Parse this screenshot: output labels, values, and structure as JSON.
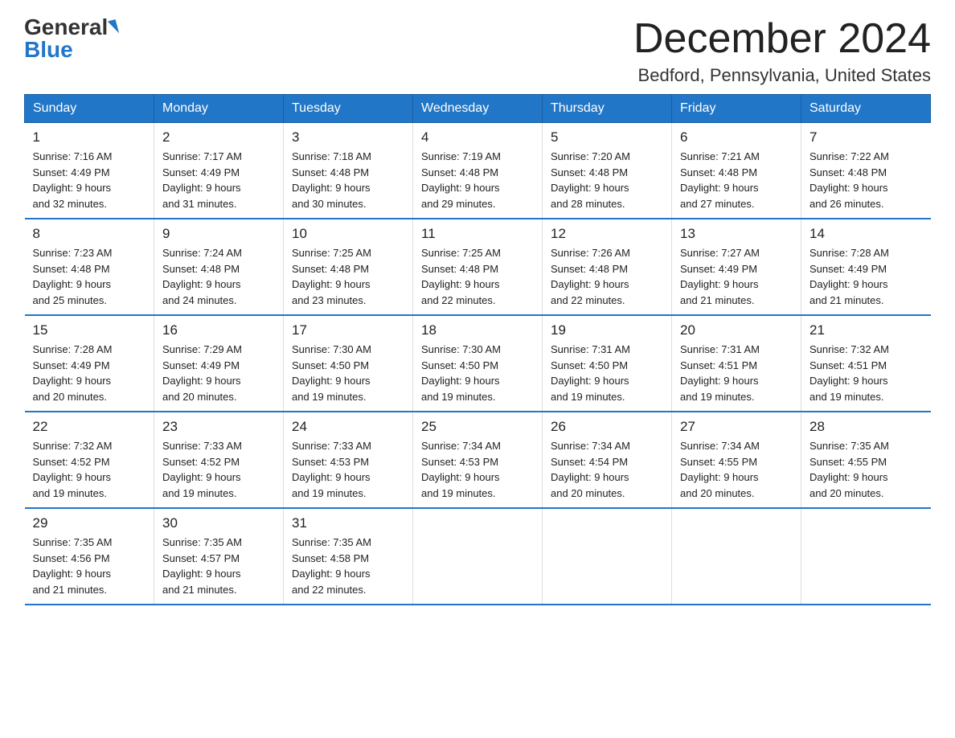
{
  "header": {
    "logo_general": "General",
    "logo_blue": "Blue",
    "title": "December 2024",
    "subtitle": "Bedford, Pennsylvania, United States"
  },
  "days_of_week": [
    "Sunday",
    "Monday",
    "Tuesday",
    "Wednesday",
    "Thursday",
    "Friday",
    "Saturday"
  ],
  "weeks": [
    [
      {
        "day": "1",
        "sunrise": "7:16 AM",
        "sunset": "4:49 PM",
        "daylight": "9 hours and 32 minutes."
      },
      {
        "day": "2",
        "sunrise": "7:17 AM",
        "sunset": "4:49 PM",
        "daylight": "9 hours and 31 minutes."
      },
      {
        "day": "3",
        "sunrise": "7:18 AM",
        "sunset": "4:48 PM",
        "daylight": "9 hours and 30 minutes."
      },
      {
        "day": "4",
        "sunrise": "7:19 AM",
        "sunset": "4:48 PM",
        "daylight": "9 hours and 29 minutes."
      },
      {
        "day": "5",
        "sunrise": "7:20 AM",
        "sunset": "4:48 PM",
        "daylight": "9 hours and 28 minutes."
      },
      {
        "day": "6",
        "sunrise": "7:21 AM",
        "sunset": "4:48 PM",
        "daylight": "9 hours and 27 minutes."
      },
      {
        "day": "7",
        "sunrise": "7:22 AM",
        "sunset": "4:48 PM",
        "daylight": "9 hours and 26 minutes."
      }
    ],
    [
      {
        "day": "8",
        "sunrise": "7:23 AM",
        "sunset": "4:48 PM",
        "daylight": "9 hours and 25 minutes."
      },
      {
        "day": "9",
        "sunrise": "7:24 AM",
        "sunset": "4:48 PM",
        "daylight": "9 hours and 24 minutes."
      },
      {
        "day": "10",
        "sunrise": "7:25 AM",
        "sunset": "4:48 PM",
        "daylight": "9 hours and 23 minutes."
      },
      {
        "day": "11",
        "sunrise": "7:25 AM",
        "sunset": "4:48 PM",
        "daylight": "9 hours and 22 minutes."
      },
      {
        "day": "12",
        "sunrise": "7:26 AM",
        "sunset": "4:48 PM",
        "daylight": "9 hours and 22 minutes."
      },
      {
        "day": "13",
        "sunrise": "7:27 AM",
        "sunset": "4:49 PM",
        "daylight": "9 hours and 21 minutes."
      },
      {
        "day": "14",
        "sunrise": "7:28 AM",
        "sunset": "4:49 PM",
        "daylight": "9 hours and 21 minutes."
      }
    ],
    [
      {
        "day": "15",
        "sunrise": "7:28 AM",
        "sunset": "4:49 PM",
        "daylight": "9 hours and 20 minutes."
      },
      {
        "day": "16",
        "sunrise": "7:29 AM",
        "sunset": "4:49 PM",
        "daylight": "9 hours and 20 minutes."
      },
      {
        "day": "17",
        "sunrise": "7:30 AM",
        "sunset": "4:50 PM",
        "daylight": "9 hours and 19 minutes."
      },
      {
        "day": "18",
        "sunrise": "7:30 AM",
        "sunset": "4:50 PM",
        "daylight": "9 hours and 19 minutes."
      },
      {
        "day": "19",
        "sunrise": "7:31 AM",
        "sunset": "4:50 PM",
        "daylight": "9 hours and 19 minutes."
      },
      {
        "day": "20",
        "sunrise": "7:31 AM",
        "sunset": "4:51 PM",
        "daylight": "9 hours and 19 minutes."
      },
      {
        "day": "21",
        "sunrise": "7:32 AM",
        "sunset": "4:51 PM",
        "daylight": "9 hours and 19 minutes."
      }
    ],
    [
      {
        "day": "22",
        "sunrise": "7:32 AM",
        "sunset": "4:52 PM",
        "daylight": "9 hours and 19 minutes."
      },
      {
        "day": "23",
        "sunrise": "7:33 AM",
        "sunset": "4:52 PM",
        "daylight": "9 hours and 19 minutes."
      },
      {
        "day": "24",
        "sunrise": "7:33 AM",
        "sunset": "4:53 PM",
        "daylight": "9 hours and 19 minutes."
      },
      {
        "day": "25",
        "sunrise": "7:34 AM",
        "sunset": "4:53 PM",
        "daylight": "9 hours and 19 minutes."
      },
      {
        "day": "26",
        "sunrise": "7:34 AM",
        "sunset": "4:54 PM",
        "daylight": "9 hours and 20 minutes."
      },
      {
        "day": "27",
        "sunrise": "7:34 AM",
        "sunset": "4:55 PM",
        "daylight": "9 hours and 20 minutes."
      },
      {
        "day": "28",
        "sunrise": "7:35 AM",
        "sunset": "4:55 PM",
        "daylight": "9 hours and 20 minutes."
      }
    ],
    [
      {
        "day": "29",
        "sunrise": "7:35 AM",
        "sunset": "4:56 PM",
        "daylight": "9 hours and 21 minutes."
      },
      {
        "day": "30",
        "sunrise": "7:35 AM",
        "sunset": "4:57 PM",
        "daylight": "9 hours and 21 minutes."
      },
      {
        "day": "31",
        "sunrise": "7:35 AM",
        "sunset": "4:58 PM",
        "daylight": "9 hours and 22 minutes."
      },
      null,
      null,
      null,
      null
    ]
  ],
  "labels": {
    "sunrise": "Sunrise: ",
    "sunset": "Sunset: ",
    "daylight": "Daylight: "
  }
}
